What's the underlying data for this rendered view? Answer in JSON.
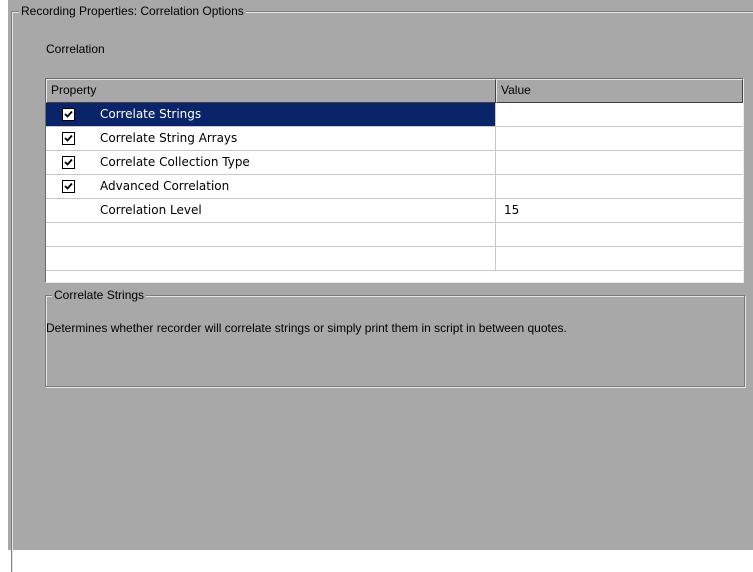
{
  "window": {
    "group_title": "Recording Properties: Correlation Options",
    "section_label": "Correlation"
  },
  "table": {
    "columns": [
      "Property",
      "Value"
    ],
    "rows": [
      {
        "label": "Correlate Strings",
        "checked": true,
        "value": "",
        "selected": true
      },
      {
        "label": "Correlate String Arrays",
        "checked": true,
        "value": "",
        "selected": false
      },
      {
        "label": "Correlate Collection Type",
        "checked": true,
        "value": "",
        "selected": false
      },
      {
        "label": "Advanced Correlation",
        "checked": true,
        "value": "",
        "selected": false
      },
      {
        "label": "Correlation Level",
        "checked": null,
        "value": "15",
        "selected": false
      },
      {
        "label": "",
        "checked": null,
        "value": "",
        "selected": false
      },
      {
        "label": "",
        "checked": null,
        "value": "",
        "selected": false
      }
    ]
  },
  "description": {
    "title": "Correlate Strings",
    "text": "Determines whether recorder will correlate strings or simply print them in script in between quotes."
  },
  "colors": {
    "panel_bg": "#a8a8a8",
    "selection_bg": "#0a246a",
    "selection_text": "#ffffff",
    "table_bg": "#ffffff"
  },
  "icons": {
    "checkbox": "checkbox-checked-icon"
  }
}
